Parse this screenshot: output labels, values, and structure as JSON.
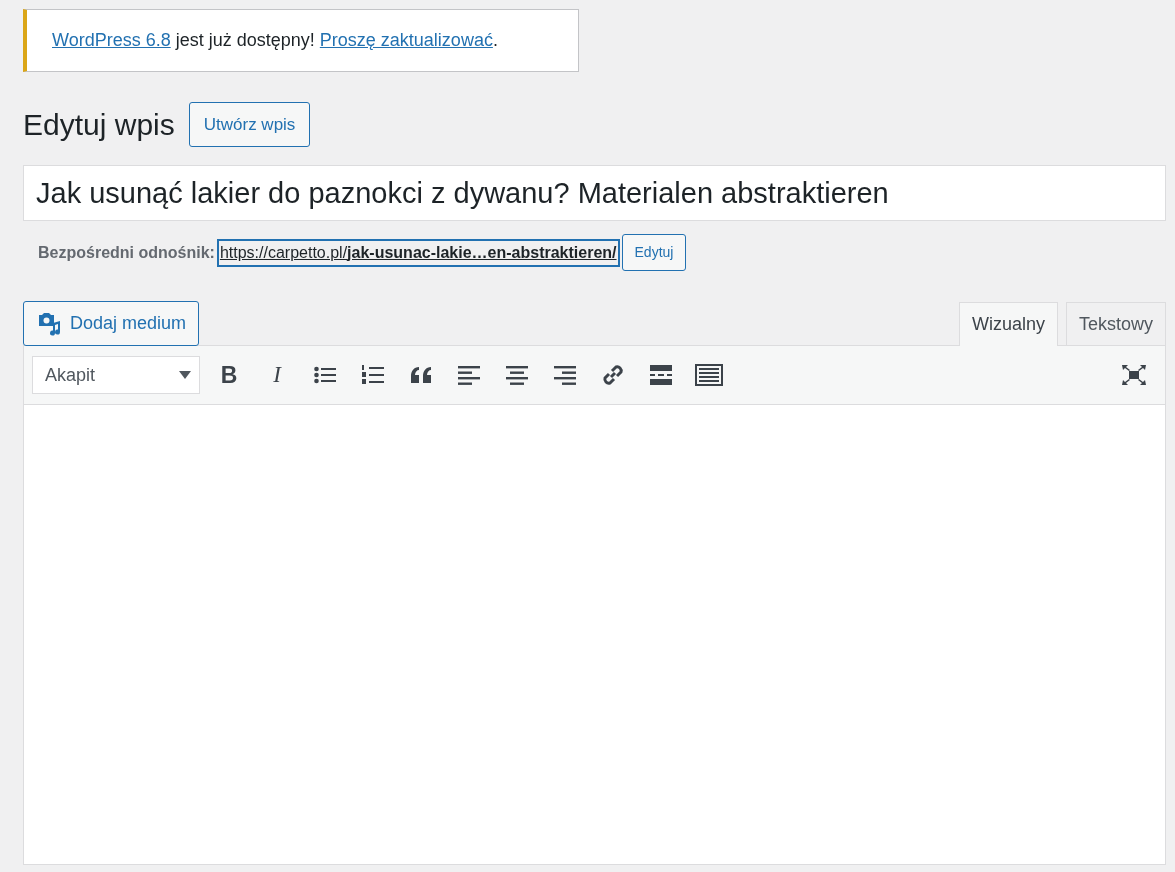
{
  "notice": {
    "parts": [
      {
        "text": "WordPress 6.8",
        "link": true
      },
      {
        "text": " jest już dostępny! ",
        "link": false
      },
      {
        "text": "Proszę zaktualizować",
        "link": true
      },
      {
        "text": ".",
        "link": false
      }
    ]
  },
  "heading": {
    "title": "Edytuj wpis",
    "button": "Utwórz wpis"
  },
  "post_title": {
    "value": "Jak usunąć lakier do paznokci z dywanu? Materialen abstraktieren"
  },
  "permalink": {
    "label": "Bezpośredni odnośnik:",
    "url": "https://carpetto.pl/**jak-usunac-lakie…en-abstraktieren/**",
    "button": "Edytuj"
  },
  "media_button": "Dodaj medium",
  "tabs": [
    {
      "label": "Wizualny",
      "selected": true
    },
    {
      "label": "Tekstowy",
      "selected": false
    }
  ],
  "toolbar": {
    "format_select": "Akapit",
    "buttons": [
      {
        "kind": "bold",
        "label": "B"
      },
      {
        "kind": "italic",
        "label": "I"
      },
      {
        "kind": "bullets"
      },
      {
        "kind": "numbers"
      },
      {
        "kind": "quote"
      },
      {
        "kind": "align-left"
      },
      {
        "kind": "align-center"
      },
      {
        "kind": "align-right"
      },
      {
        "kind": "link"
      },
      {
        "kind": "more"
      },
      {
        "kind": "toolbar-toggle"
      }
    ]
  }
}
